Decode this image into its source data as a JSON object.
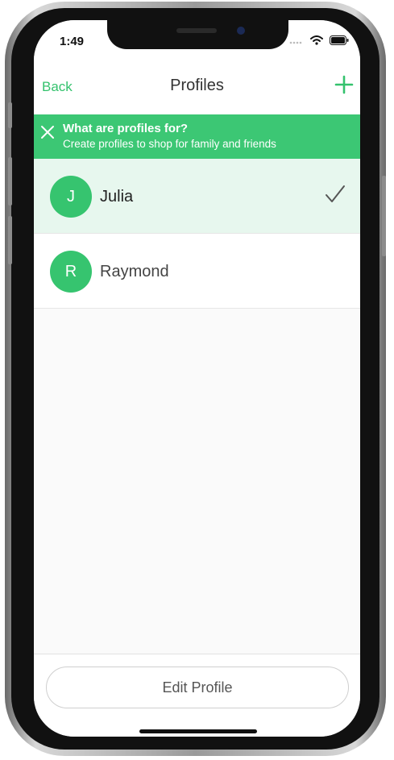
{
  "status_bar": {
    "time": "1:49"
  },
  "nav": {
    "back_label": "Back",
    "title": "Profiles"
  },
  "banner": {
    "title": "What are profiles for?",
    "subtitle": "Create profiles to shop for family and friends"
  },
  "profiles": [
    {
      "initial": "J",
      "name": "Julia",
      "selected": true
    },
    {
      "initial": "R",
      "name": "Raymond",
      "selected": false
    }
  ],
  "footer": {
    "edit_label": "Edit Profile"
  },
  "colors": {
    "accent": "#34c26d",
    "banner": "#3cc774",
    "selected_row": "#e7f7ee"
  },
  "icons": [
    "wifi-icon",
    "battery-icon",
    "plus-icon",
    "close-icon",
    "checkmark-icon"
  ]
}
